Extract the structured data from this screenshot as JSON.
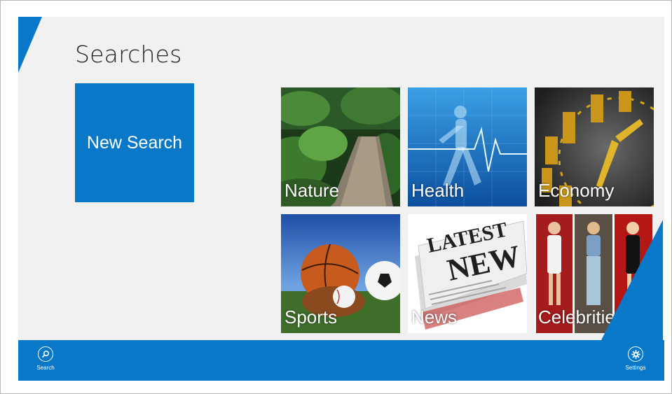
{
  "page": {
    "title": "Searches"
  },
  "new_search": {
    "label": "New Search"
  },
  "tiles": [
    {
      "label": "Nature"
    },
    {
      "label": "Health"
    },
    {
      "label": "Economy"
    },
    {
      "label": "Sports"
    },
    {
      "label": "News"
    },
    {
      "label": "Celebrities"
    }
  ],
  "appbar": {
    "search_label": "Search",
    "search_icon": "search-icon",
    "settings_label": "Settings",
    "settings_icon": "gear-icon"
  },
  "colors": {
    "accent": "#0a78c8",
    "background": "#f1f1f1",
    "title_text": "#222222"
  }
}
